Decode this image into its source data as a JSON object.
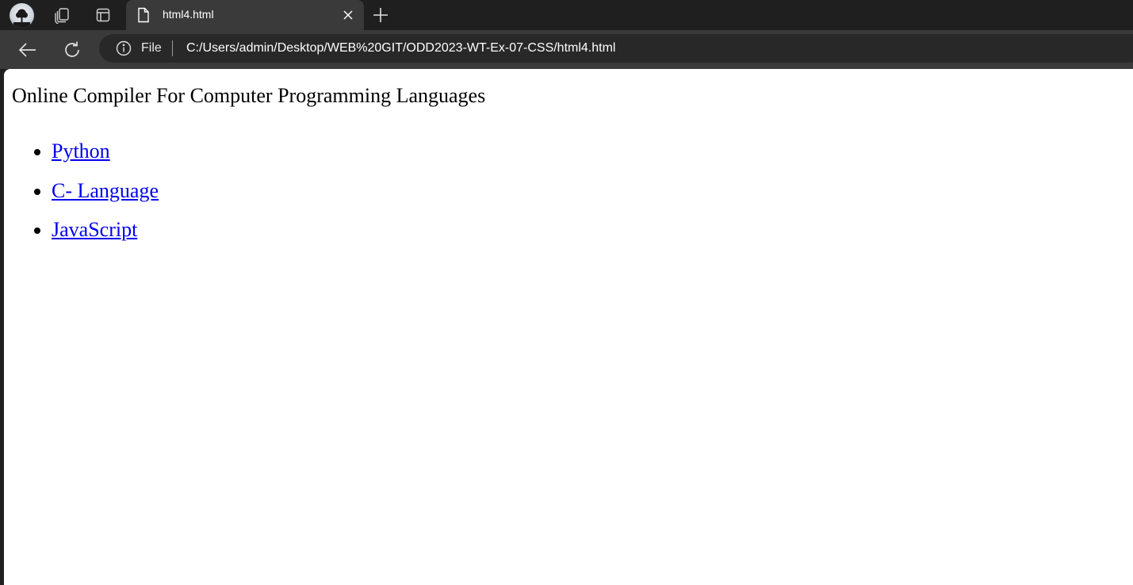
{
  "tabstrip": {
    "profile_icon": "profile-avatar-icon",
    "workspaces_icon": "workspaces-icon",
    "tab_actions_icon": "tab-actions-icon",
    "tab": {
      "title": "html4.html",
      "icon": "file-icon",
      "close_icon": "close-icon"
    },
    "new_tab_icon": "plus-icon"
  },
  "toolbar": {
    "back_icon": "back-arrow-icon",
    "refresh_icon": "refresh-icon",
    "site_info_icon": "info-icon",
    "scheme_label": "File",
    "url": "C:/Users/admin/Desktop/WEB%20GIT/ODD2023-WT-Ex-07-CSS/html4.html"
  },
  "page": {
    "heading": "Online Compiler For Computer Programming Languages",
    "links": [
      {
        "label": "Python"
      },
      {
        "label": "C- Language"
      },
      {
        "label": "JavaScript"
      }
    ]
  },
  "colors": {
    "chrome_dark": "#1f1f1f",
    "toolbar": "#3a3a3a",
    "omnibox": "#282828",
    "link": "#0000ee",
    "page_bg": "#ffffff"
  }
}
